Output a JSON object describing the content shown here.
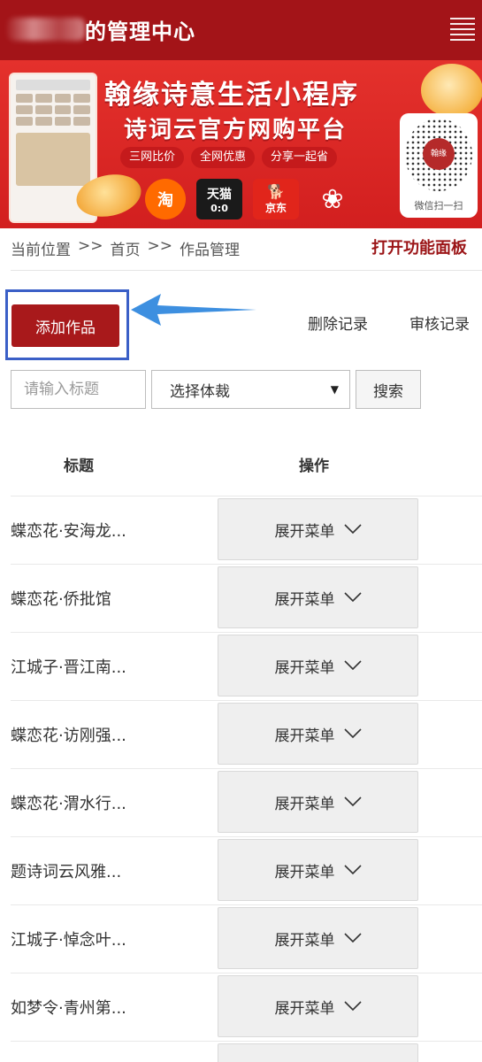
{
  "header": {
    "title": "的管理中心"
  },
  "banner": {
    "headline": "翰缘诗意生活小程序",
    "subhead": "诗词云官方网购平台",
    "tags": [
      "三网比价",
      "全网优惠",
      "分享一起省"
    ],
    "stores": {
      "taobao": "淘",
      "tmall": "天猫",
      "tmall_sub": "0:0",
      "jd": "京东",
      "jd_icon": "🐕",
      "pdd": "❀"
    },
    "qr_logo": "翰缘",
    "qr_caption": "微信扫一扫"
  },
  "breadcrumb": {
    "label": "当前位置",
    "sep": ">>",
    "home": "首页",
    "current": "作品管理"
  },
  "panel_link": "打开功能面板",
  "actions": {
    "add": "添加作品",
    "delete_log": "删除记录",
    "review_log": "审核记录"
  },
  "search": {
    "placeholder": "请输入标题",
    "genre": "选择体裁",
    "caret": "▼",
    "button": "搜索"
  },
  "table": {
    "col_title": "标题",
    "col_action": "操作",
    "menu_label": "展开菜单",
    "rows": [
      "蝶恋花·安海龙...",
      "蝶恋花·侨批馆",
      "江城子·晋江南...",
      "蝶恋花·访刚强...",
      "蝶恋花·渭水行...",
      "题诗词云风雅...",
      "江城子·悼念叶...",
      "如梦令·青州第..."
    ]
  },
  "colors": {
    "header": "#a31418",
    "primary_button": "#a8191b",
    "highlight": "#3a5fc7",
    "arrow": "#3d8fe0"
  }
}
